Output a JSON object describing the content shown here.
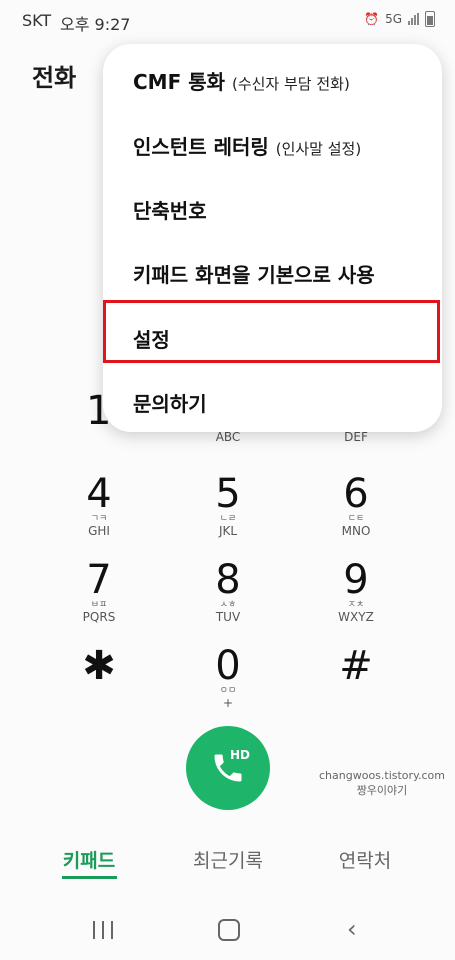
{
  "status": {
    "carrier": "SKT",
    "time": "오후 9:27",
    "net": "5G"
  },
  "header": {
    "title": "전화"
  },
  "menu": {
    "items": [
      {
        "label": "CMF 통화",
        "sub": "(수신자 부담 전화)"
      },
      {
        "label": "인스턴트 레터링",
        "sub": "(인사말 설정)"
      },
      {
        "label": "단축번호",
        "sub": ""
      },
      {
        "label": "키패드 화면을 기본으로 사용",
        "sub": ""
      },
      {
        "label": "설정",
        "sub": ""
      },
      {
        "label": "문의하기",
        "sub": ""
      }
    ]
  },
  "keypad": {
    "partial_first": "1",
    "row1_sub": {
      "abc": "ABC",
      "def": "DEF"
    },
    "keys": [
      {
        "num": "4",
        "ko": "ㄱㅋ",
        "en": "GHI"
      },
      {
        "num": "5",
        "ko": "ㄴㄹ",
        "en": "JKL"
      },
      {
        "num": "6",
        "ko": "ㄷㅌ",
        "en": "MNO"
      },
      {
        "num": "7",
        "ko": "ㅂㅍ",
        "en": "PQRS"
      },
      {
        "num": "8",
        "ko": "ㅅㅎ",
        "en": "TUV"
      },
      {
        "num": "9",
        "ko": "ㅈㅊ",
        "en": "WXYZ"
      },
      {
        "num": "✱",
        "ko": "",
        "en": ""
      },
      {
        "num": "0",
        "ko": "ㅇㅁ",
        "en": "+"
      },
      {
        "num": "#",
        "ko": "",
        "en": ""
      }
    ]
  },
  "call": {
    "badge": "HD"
  },
  "watermark": {
    "line1": "changwoos.tistory.com",
    "line2": "짱우이야기"
  },
  "tabs": {
    "keypad": "키패드",
    "recent": "최근기록",
    "contacts": "연락처"
  },
  "colors": {
    "accent": "#1b9b58",
    "call": "#1eb46a",
    "highlight": "#e0141a"
  }
}
